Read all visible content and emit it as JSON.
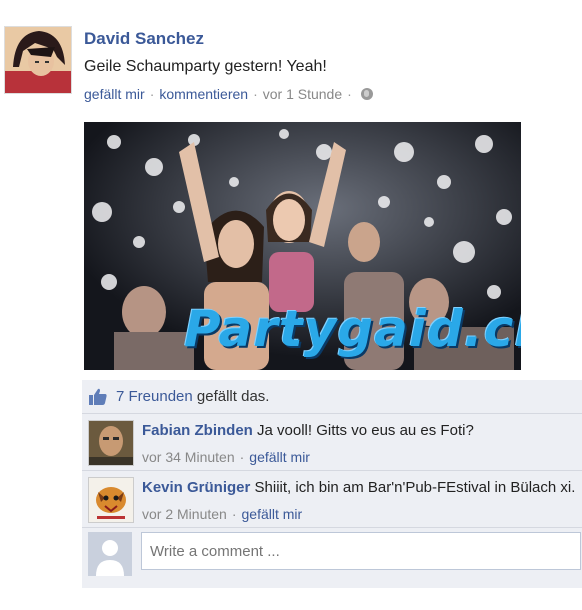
{
  "post": {
    "author": "David Sanchez",
    "text": "Geile Schaumparty gestern! Yeah!",
    "like_link": "gefällt mir",
    "comment_link": "kommentieren",
    "time": "vor 1 Stunde",
    "sep": "·",
    "photo_watermark": "Partygaid.ch"
  },
  "likes": {
    "friends_link": "7 Freunden",
    "suffix": "gefällt das."
  },
  "comments": [
    {
      "name": "Fabian Zbinden",
      "text": "Ja vooll! Gitts vo eus au es Foti?",
      "time": "vor 34 Minuten",
      "like": "gefällt mir"
    },
    {
      "name": "Kevin Grüniger",
      "text": "Shiiit, ich bin am Bar'n'Pub-FEstival in Bülach xi.",
      "time": "vor 2 Minuten",
      "like": "gefällt mir"
    }
  ],
  "composer": {
    "placeholder": "Write a comment ..."
  },
  "colors": {
    "link": "#3b5998",
    "feedback_bg": "#edeff4"
  },
  "icons": {
    "privacy": "globe-icon",
    "like": "thumbs-up-icon"
  }
}
